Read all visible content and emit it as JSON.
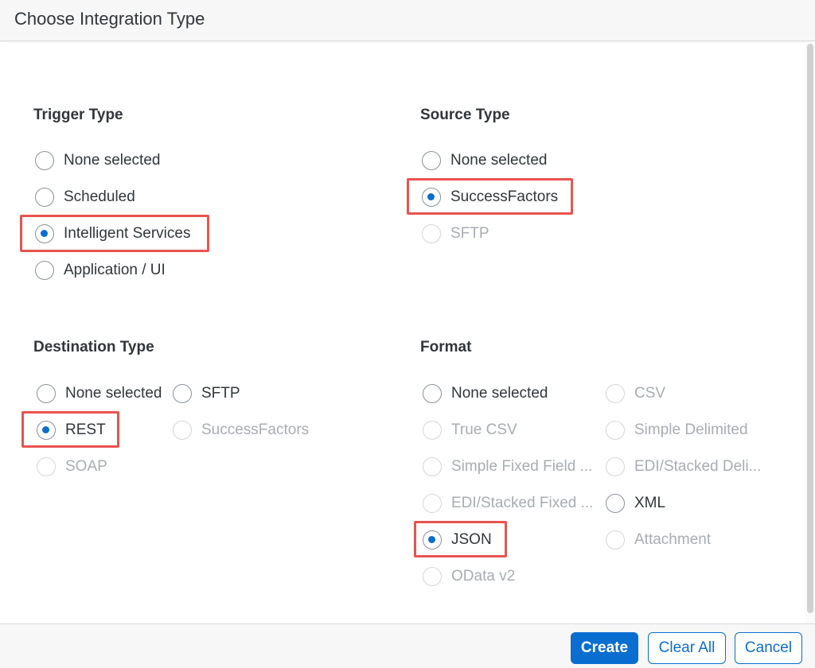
{
  "dialog": {
    "title": "Choose Integration Type"
  },
  "trigger_type": {
    "title": "Trigger Type",
    "options": [
      {
        "label": "None selected",
        "selected": false,
        "disabled": false
      },
      {
        "label": "Scheduled",
        "selected": false,
        "disabled": false
      },
      {
        "label": "Intelligent Services",
        "selected": true,
        "disabled": false
      },
      {
        "label": "Application / UI",
        "selected": false,
        "disabled": false
      }
    ]
  },
  "source_type": {
    "title": "Source Type",
    "options": [
      {
        "label": "None selected",
        "selected": false,
        "disabled": false
      },
      {
        "label": "SuccessFactors",
        "selected": true,
        "disabled": false
      },
      {
        "label": "SFTP",
        "selected": false,
        "disabled": true
      }
    ]
  },
  "destination_type": {
    "title": "Destination Type",
    "options": [
      {
        "label": "None selected",
        "selected": false,
        "disabled": false
      },
      {
        "label": "SFTP",
        "selected": false,
        "disabled": false
      },
      {
        "label": "REST",
        "selected": true,
        "disabled": false
      },
      {
        "label": "SuccessFactors",
        "selected": false,
        "disabled": true
      },
      {
        "label": "SOAP",
        "selected": false,
        "disabled": true
      }
    ]
  },
  "format": {
    "title": "Format",
    "options": [
      {
        "label": "None selected",
        "selected": false,
        "disabled": false
      },
      {
        "label": "CSV",
        "selected": false,
        "disabled": true
      },
      {
        "label": "True CSV",
        "selected": false,
        "disabled": true
      },
      {
        "label": "Simple Delimited",
        "selected": false,
        "disabled": true
      },
      {
        "label": "Simple Fixed Field ...",
        "selected": false,
        "disabled": true
      },
      {
        "label": "EDI/Stacked Deli...",
        "selected": false,
        "disabled": true
      },
      {
        "label": "EDI/Stacked Fixed ...",
        "selected": false,
        "disabled": true
      },
      {
        "label": "XML",
        "selected": false,
        "disabled": false
      },
      {
        "label": "JSON",
        "selected": true,
        "disabled": false
      },
      {
        "label": "Attachment",
        "selected": false,
        "disabled": true
      },
      {
        "label": "OData v2",
        "selected": false,
        "disabled": true
      }
    ]
  },
  "footer": {
    "create_label": "Create",
    "clear_all_label": "Clear All",
    "cancel_label": "Cancel"
  },
  "colors": {
    "accent": "#0a6ed1",
    "highlight": "#e9534f",
    "disabled_text": "#a8adb2"
  }
}
